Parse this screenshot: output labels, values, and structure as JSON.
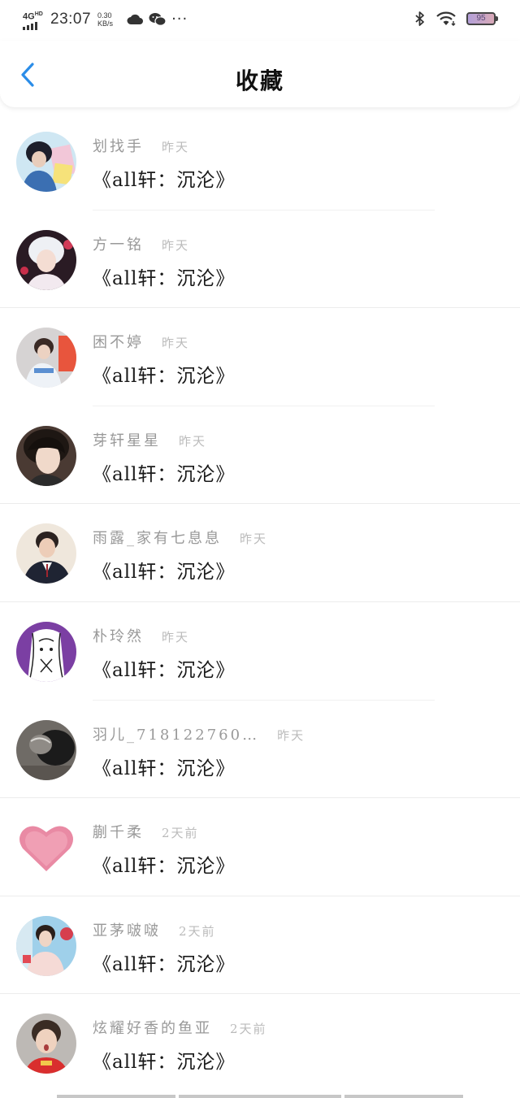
{
  "status_bar": {
    "network": "4G",
    "network_suffix": "HD",
    "time": "23:07",
    "speed_value": "0.30",
    "speed_unit": "KB/s",
    "more": "···",
    "battery": "95"
  },
  "header": {
    "title": "收藏"
  },
  "colors": {
    "accent": "#2b8de8",
    "name_gray": "#999999",
    "time_gray": "#bbbbbb"
  },
  "items": [
    {
      "name": "划找手",
      "time": "昨天",
      "title": "《all轩：沉沦》"
    },
    {
      "name": "方一铭",
      "time": "昨天",
      "title": "《all轩：沉沦》"
    },
    {
      "name": "困不婷",
      "time": "昨天",
      "title": "《all轩：沉沦》"
    },
    {
      "name": "芽轩星星",
      "time": "昨天",
      "title": "《all轩：沉沦》"
    },
    {
      "name": "雨露_家有七息息",
      "time": "昨天",
      "title": "《all轩：沉沦》"
    },
    {
      "name": "朴玲然",
      "time": "昨天",
      "title": "《all轩：沉沦》"
    },
    {
      "name": "羽儿_718122760…",
      "time": "昨天",
      "title": "《all轩：沉沦》"
    },
    {
      "name": "蒯千柔",
      "time": "2天前",
      "title": "《all轩：沉沦》"
    },
    {
      "name": "亚茅啵啵",
      "time": "2天前",
      "title": "《all轩：沉沦》"
    },
    {
      "name": "炫耀好香的鱼亚",
      "time": "2天前",
      "title": "《all轩：沉沦》"
    }
  ]
}
